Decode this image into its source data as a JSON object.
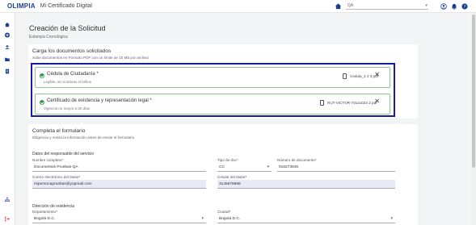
{
  "header": {
    "logo": "OLIMPIA",
    "app_title": "Mi Certificado Digital",
    "select_value": "QA"
  },
  "page": {
    "title": "Creación de la Solicitud",
    "subtitle": "Estampa Cronológica"
  },
  "upload": {
    "title": "Carga los documentos solicitados",
    "subtitle": "Sube documentos en Formato PDF con un límite de 10 Mb por archivo",
    "documents": [
      {
        "label": "Cédula de Ciudadanía *",
        "hint": "Legible, sin sombras ni brillos",
        "file": "Cedula_1 2 3.pdf"
      },
      {
        "label": "Certificado de existencia y representación legal *",
        "hint": "Vigencia no mayor a 30 días",
        "file": "RUT-VICTOR-701a1024 2.pdf"
      }
    ]
  },
  "form": {
    "title": "Completa el formulario",
    "subtitle": "Diligencia y revisa la información antes de enviar el formulario",
    "responsible_title": "Datos del responsable del servicio",
    "fields": {
      "nombre_label": "Nombre completo*",
      "nombre_value": "Documentos Pruebas QA",
      "tipo_doc_label": "Tipo de doc*",
      "tipo_doc_value": "CC",
      "num_doc_label": "Número de documento*",
      "num_doc_value": "916273645",
      "correo_label": "Correo electrónico del titular*",
      "correo_value": "mipersonapruebas@yopmail.com",
      "celular_label": "Celular del titular*",
      "celular_value": "3145678888"
    },
    "address_title": "Dirección de residencia",
    "address": {
      "depto_label": "Departamento*",
      "depto_value": "Bogotá D.C.",
      "ciudad_label": "Ciudad*",
      "ciudad_value": "Bogotá D.C."
    }
  },
  "colors": {
    "brand": "#1a3d8f",
    "success": "#2e9b47",
    "highlight": "#1a1aa8",
    "filled_input": "#e8eaf7"
  },
  "icons": {
    "sidebar": [
      "home-icon",
      "add-circle-icon",
      "upload-icon",
      "folder-icon",
      "document-icon",
      "org-chart-icon",
      "logout-icon"
    ],
    "topbar": [
      "home-icon",
      "account-icon",
      "bell-icon",
      "help-icon"
    ]
  }
}
